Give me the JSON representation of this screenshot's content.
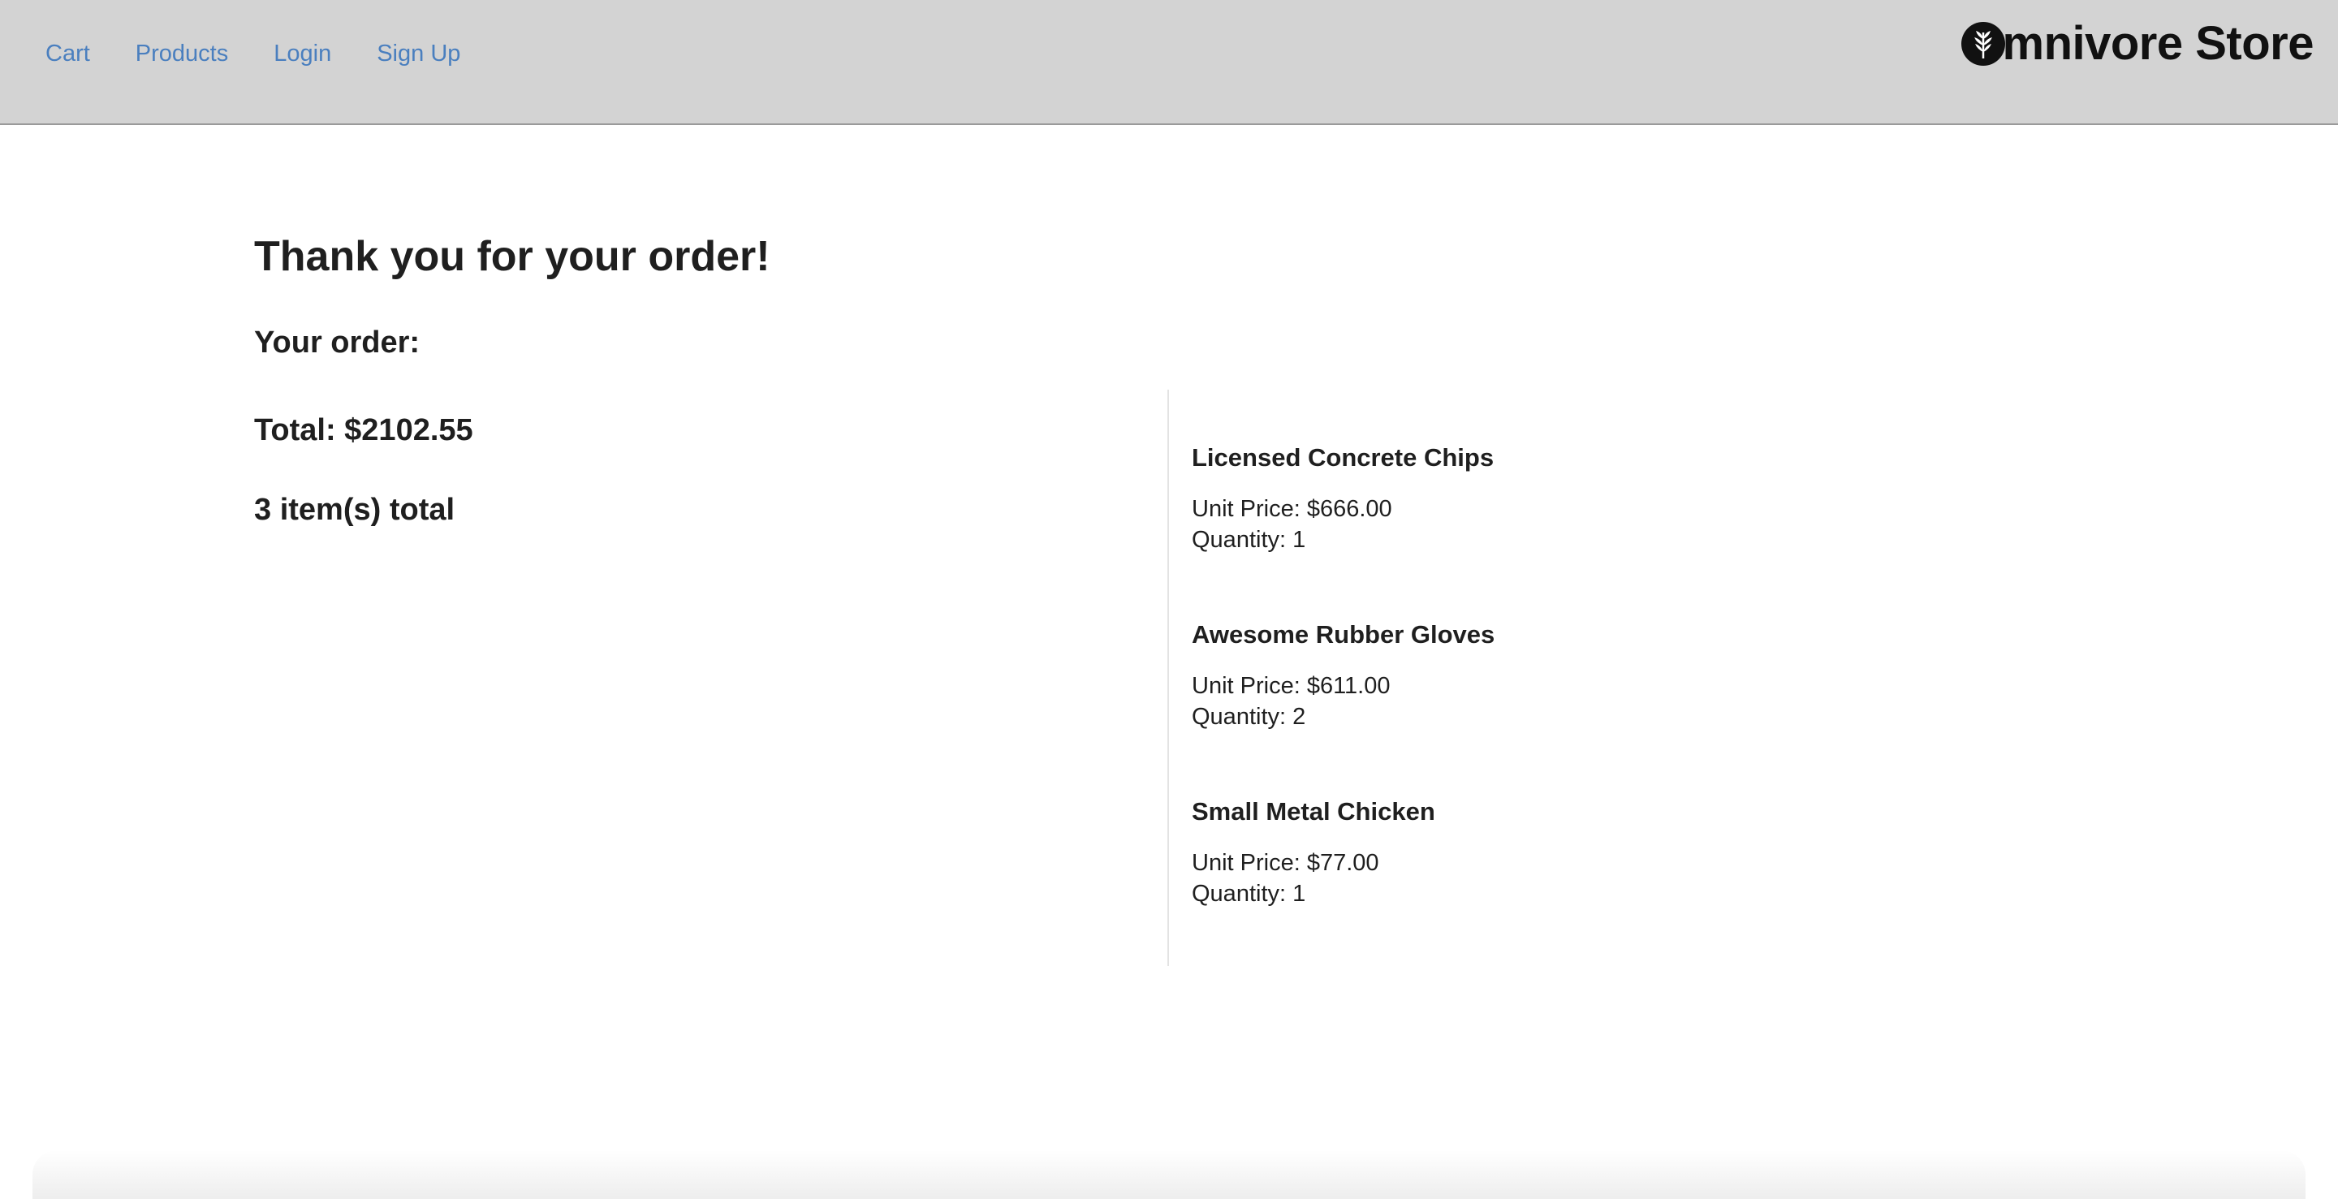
{
  "nav": {
    "links": [
      "Cart",
      "Products",
      "Login",
      "Sign Up"
    ],
    "brand": "mnivore Store",
    "brand_icon": "leaf-circle-icon",
    "link_color": "#4a7fbf",
    "bar_color": "#d3d3d3"
  },
  "page": {
    "title": "Thank you for your order!",
    "order_label": "Your order:"
  },
  "summary": {
    "total": "Total: $2102.55",
    "count": "3 item(s) total"
  },
  "items": [
    {
      "name": "Licensed Concrete Chips",
      "unit_price": "Unit Price: $666.00",
      "quantity": "Quantity: 1"
    },
    {
      "name": "Awesome Rubber Gloves",
      "unit_price": "Unit Price: $611.00",
      "quantity": "Quantity: 2"
    },
    {
      "name": "Small Metal Chicken",
      "unit_price": "Unit Price: $77.00",
      "quantity": "Quantity: 1"
    }
  ]
}
